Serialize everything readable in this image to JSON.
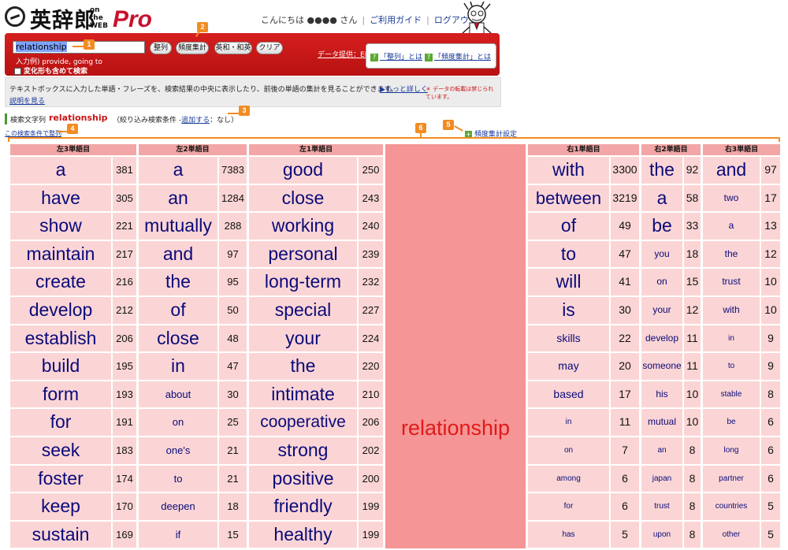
{
  "header": {
    "logo_kanji": "英辞郎",
    "logo_ontheweb": "on the WEB",
    "logo_pro": "Pro",
    "greeting": "こんにちは ●●●● さん",
    "guide_link": "ご利用ガイド",
    "logout_link": "ログアウト"
  },
  "search": {
    "query": "relationship",
    "example_label": "入力例) provide, going to",
    "variant_label": "変化形も含めて検索",
    "buttons": [
      "整列",
      "頻度集計",
      "英和・和英",
      "クリア"
    ],
    "data_provider": "データ提供：EDP",
    "help_sort": "「整列」とは",
    "help_freq": "「頻度集計」とは"
  },
  "info": {
    "text": "テキストボックスに入力した単語・フレーズを、検索結果の中央に表示したり、前後の単語の集計を見ることができます。",
    "more": "もっと詳しく",
    "note": "＊ データの転載は禁じられています。",
    "explain": "説明を見る"
  },
  "search_string": {
    "label": "検索文字列",
    "value": "relationship",
    "filter_prefix": "（絞り込み検索条件 -",
    "filter_link": "追加する",
    "filter_suffix": "：なし）",
    "sort_link": "この検索条件で整列",
    "freq_setting": "頻度集計設定"
  },
  "callouts": [
    "1",
    "2",
    "3",
    "4",
    "5",
    "6"
  ],
  "table": {
    "headers": [
      "左3単語目",
      "左2単語目",
      "左1単語目",
      "右1単語目",
      "右2単語目",
      "右3単語目"
    ],
    "center_word": "relationship",
    "rows": [
      {
        "l3": "a",
        "l3n": "381",
        "l2": "a",
        "l2n": "7383",
        "l1": "good",
        "l1n": "250",
        "r1": "with",
        "r1n": "3300",
        "r2": "the",
        "r2n": "92",
        "r3": "and",
        "r3n": "97"
      },
      {
        "l3": "have",
        "l3n": "305",
        "l2": "an",
        "l2n": "1284",
        "l1": "close",
        "l1n": "243",
        "r1": "between",
        "r1n": "3219",
        "r2": "a",
        "r2n": "58",
        "r3": "two",
        "r3n": "17"
      },
      {
        "l3": "show",
        "l3n": "221",
        "l2": "mutually",
        "l2n": "288",
        "l1": "working",
        "l1n": "240",
        "r1": "of",
        "r1n": "49",
        "r2": "be",
        "r2n": "33",
        "r3": "a",
        "r3n": "13"
      },
      {
        "l3": "maintain",
        "l3n": "217",
        "l2": "and",
        "l2n": "97",
        "l1": "personal",
        "l1n": "239",
        "r1": "to",
        "r1n": "47",
        "r2": "you",
        "r2n": "18",
        "r3": "the",
        "r3n": "12"
      },
      {
        "l3": "create",
        "l3n": "216",
        "l2": "the",
        "l2n": "95",
        "l1": "long-term",
        "l1n": "232",
        "r1": "will",
        "r1n": "41",
        "r2": "on",
        "r2n": "15",
        "r3": "trust",
        "r3n": "10"
      },
      {
        "l3": "develop",
        "l3n": "212",
        "l2": "of",
        "l2n": "50",
        "l1": "special",
        "l1n": "227",
        "r1": "is",
        "r1n": "30",
        "r2": "your",
        "r2n": "12",
        "r3": "with",
        "r3n": "10"
      },
      {
        "l3": "establish",
        "l3n": "206",
        "l2": "close",
        "l2n": "48",
        "l1": "your",
        "l1n": "224",
        "r1": "skills",
        "r1n": "22",
        "r2": "develop",
        "r2n": "11",
        "r3": "in",
        "r3n": "9"
      },
      {
        "l3": "build",
        "l3n": "195",
        "l2": "in",
        "l2n": "47",
        "l1": "the",
        "l1n": "220",
        "r1": "may",
        "r1n": "20",
        "r2": "someone",
        "r2n": "11",
        "r3": "to",
        "r3n": "9"
      },
      {
        "l3": "form",
        "l3n": "193",
        "l2": "about",
        "l2n": "30",
        "l1": "intimate",
        "l1n": "210",
        "r1": "based",
        "r1n": "17",
        "r2": "his",
        "r2n": "10",
        "r3": "stable",
        "r3n": "8"
      },
      {
        "l3": "for",
        "l3n": "191",
        "l2": "on",
        "l2n": "25",
        "l1": "cooperative",
        "l1n": "206",
        "r1": "in",
        "r1n": "11",
        "r2": "mutual",
        "r2n": "10",
        "r3": "be",
        "r3n": "6"
      },
      {
        "l3": "seek",
        "l3n": "183",
        "l2": "one's",
        "l2n": "21",
        "l1": "strong",
        "l1n": "202",
        "r1": "on",
        "r1n": "7",
        "r2": "an",
        "r2n": "8",
        "r3": "long",
        "r3n": "6"
      },
      {
        "l3": "foster",
        "l3n": "174",
        "l2": "to",
        "l2n": "21",
        "l1": "positive",
        "l1n": "200",
        "r1": "among",
        "r1n": "6",
        "r2": "japan",
        "r2n": "8",
        "r3": "partner",
        "r3n": "6"
      },
      {
        "l3": "keep",
        "l3n": "170",
        "l2": "deepen",
        "l2n": "18",
        "l1": "friendly",
        "l1n": "199",
        "r1": "for",
        "r1n": "6",
        "r2": "trust",
        "r2n": "8",
        "r3": "countries",
        "r3n": "5"
      },
      {
        "l3": "sustain",
        "l3n": "169",
        "l2": "if",
        "l2n": "15",
        "l1": "healthy",
        "l1n": "199",
        "r1": "has",
        "r1n": "5",
        "r2": "upon",
        "r2n": "8",
        "r3": "other",
        "r3n": "5"
      }
    ]
  },
  "colors": {
    "header_red": "#c8102e",
    "cell_pink": "#fbd5d5",
    "header_pink": "#f2a6a6",
    "center_pink": "#f59595",
    "word_blue": "#0a0a7a",
    "callout_orange": "#f28c22"
  }
}
